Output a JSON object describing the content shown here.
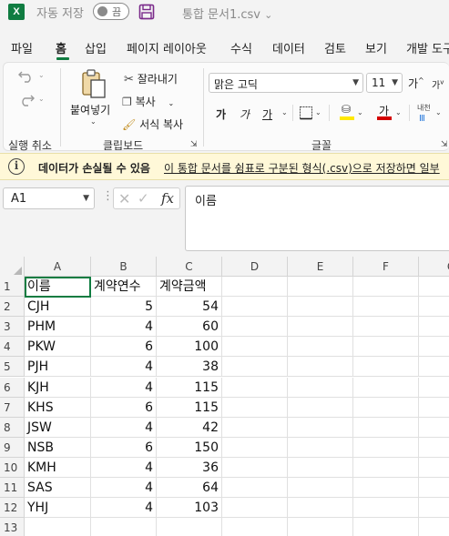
{
  "titlebar": {
    "app_icon": "X",
    "autosave_label": "자동 저장",
    "autosave_state": "끔",
    "doc_title": "통합 문서1.csv",
    "doc_title_arrow": "⌄"
  },
  "menu": {
    "tabs": [
      "파일",
      "홈",
      "삽입",
      "페이지 레이아웃",
      "수식",
      "데이터",
      "검토",
      "보기",
      "개발 도구"
    ],
    "active": "홈"
  },
  "ribbon": {
    "undo_label": "실행 취소",
    "clipboard": {
      "paste": "붙여넣기",
      "cut": "잘라내기",
      "copy": "복사",
      "format_painter": "서식 복사",
      "group_label": "클립보드"
    },
    "font": {
      "name": "맑은 고딕",
      "size": "11",
      "bold": "가",
      "italic": "가",
      "underline": "가",
      "highlight": "가",
      "font_color": "가",
      "group_label": "글꼴",
      "grow": "가",
      "shrink": "가",
      "phonetic": "내천"
    }
  },
  "infobar": {
    "bold_text": "데이터가 손실될 수 있음",
    "link_text": "이 통합 문서를 쉼표로 구분된 형식(.csv)으로 저장하면 일부"
  },
  "formula_bar": {
    "name_box": "A1",
    "formula": "이름",
    "fx": "fx"
  },
  "sheet": {
    "columns": [
      "A",
      "B",
      "C",
      "D",
      "E",
      "F",
      "G"
    ],
    "row_numbers": [
      "1",
      "2",
      "3",
      "4",
      "5",
      "6",
      "7",
      "8",
      "9",
      "10",
      "11",
      "12",
      "13"
    ],
    "header": [
      "이름",
      "계약연수",
      "계약금액"
    ],
    "rows": [
      [
        "CJH",
        "5",
        "54"
      ],
      [
        "PHM",
        "4",
        "60"
      ],
      [
        "PKW",
        "6",
        "100"
      ],
      [
        "PJH",
        "4",
        "38"
      ],
      [
        "KJH",
        "4",
        "115"
      ],
      [
        "KHS",
        "6",
        "115"
      ],
      [
        "JSW",
        "4",
        "42"
      ],
      [
        "NSB",
        "6",
        "150"
      ],
      [
        "KMH",
        "4",
        "36"
      ],
      [
        "SAS",
        "4",
        "64"
      ],
      [
        "YHJ",
        "4",
        "103"
      ]
    ],
    "selected_cell": "A1"
  },
  "colors": {
    "excel_green": "#107c41",
    "info_bg": "#fff8d8",
    "highlight_yellow": "#ffe800",
    "font_red": "#d40000"
  }
}
